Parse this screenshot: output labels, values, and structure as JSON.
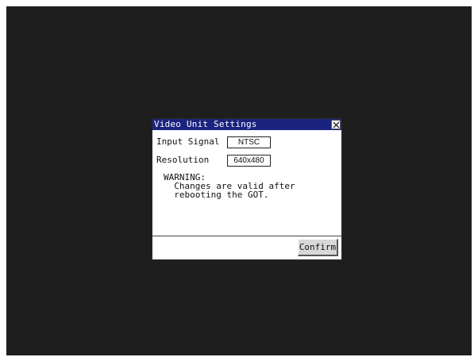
{
  "dialog": {
    "title": "Video Unit Settings",
    "close_icon": "close-icon",
    "fields": [
      {
        "label": "Input Signal",
        "value": "NTSC"
      },
      {
        "label": "Resolution",
        "value": "640x480"
      }
    ],
    "warning": {
      "heading": "WARNING:",
      "line1": "Changes are valid after",
      "line2": "rebooting the GOT."
    },
    "confirm_label": "Confirm"
  },
  "colors": {
    "screen_background": "#1e1e1e",
    "titlebar": "#1a237e",
    "dialog_background": "#ffffff"
  }
}
